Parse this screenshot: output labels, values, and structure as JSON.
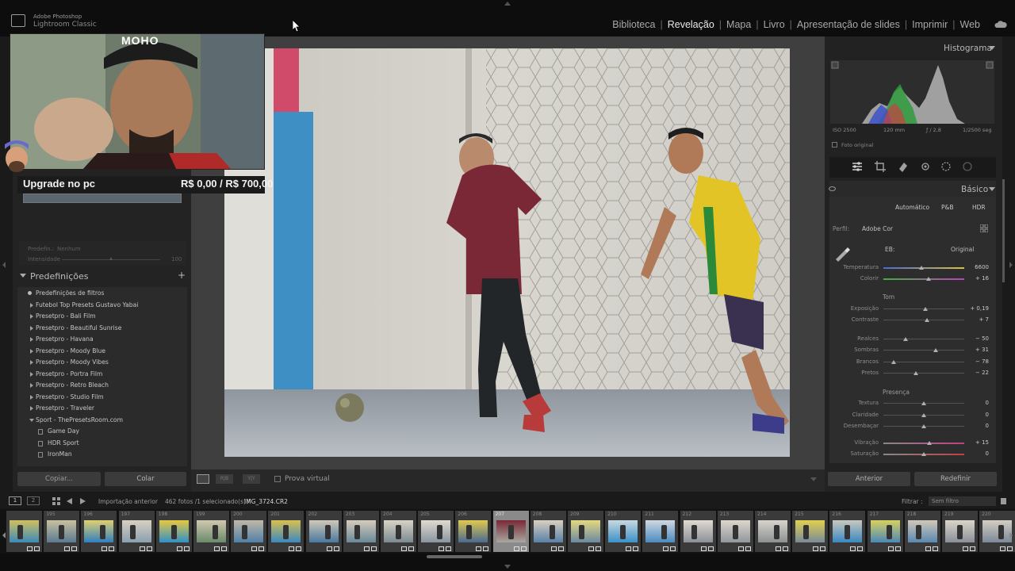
{
  "app": {
    "line1": "Adobe Photoshop",
    "line2": "Lightroom Classic"
  },
  "modules": [
    {
      "label": "Biblioteca",
      "active": false
    },
    {
      "label": "Revelação",
      "active": true
    },
    {
      "label": "Mapa",
      "active": false
    },
    {
      "label": "Livro",
      "active": false
    },
    {
      "label": "Apresentação de slides",
      "active": false
    },
    {
      "label": "Imprimir",
      "active": false
    },
    {
      "label": "Web",
      "active": false
    }
  ],
  "overlay": {
    "left_text": "Upgrade no pc",
    "right_text": "R$ 0,00 / R$ 700,00",
    "badge": "MOHO"
  },
  "left": {
    "preset_label": "Predefin.:",
    "preset_value": "Nenhum",
    "intensity_label": "Intensidade",
    "intensity_value": "100",
    "presets_title": "Predefinições",
    "items": [
      {
        "label": "Predefinições de filtros",
        "kind": "plain"
      },
      {
        "label": "Futebol Top Presets Gustavo Yabai",
        "kind": "folder"
      },
      {
        "label": "Presetpro - Bali Film",
        "kind": "folder"
      },
      {
        "label": "Presetpro - Beautiful Sunrise",
        "kind": "folder"
      },
      {
        "label": "Presetpro - Havana",
        "kind": "folder"
      },
      {
        "label": "Presetpro - Moody Blue",
        "kind": "folder"
      },
      {
        "label": "Presetpro - Moody Vibes",
        "kind": "folder"
      },
      {
        "label": "Presetpro - Portra Film",
        "kind": "folder"
      },
      {
        "label": "Presetpro - Retro Bleach",
        "kind": "folder"
      },
      {
        "label": "Presetpro - Studio Film",
        "kind": "folder"
      },
      {
        "label": "Presetpro - Traveler",
        "kind": "folder"
      },
      {
        "label": "Sport - ThePresetsRoom.com",
        "kind": "open"
      },
      {
        "label": "Game Day",
        "kind": "sub"
      },
      {
        "label": "HDR Sport",
        "kind": "sub"
      },
      {
        "label": "IronMan",
        "kind": "sub"
      }
    ],
    "copy_label": "Copiar...",
    "paste_label": "Colar"
  },
  "toolbar": {
    "view2": "R|B",
    "view3": "Y|Y",
    "proof_label": "Prova virtual"
  },
  "right": {
    "histogram_title": "Histograma",
    "hist_info": [
      "ISO 2500",
      "120 mm",
      "ƒ / 2,8",
      "1/2500 seg"
    ],
    "original_photo": "Foto original",
    "basic_title": "Básico",
    "modes": [
      "Automático",
      "P&B",
      "HDR"
    ],
    "profile_label": "Perfil:",
    "profile_value": "Adobe Cor",
    "wb_label": "EB:",
    "wb_value": "Original",
    "sections": {
      "tone": "Tom",
      "presence": "Presença"
    },
    "sliders": [
      {
        "label": "Temperatura",
        "value": "6600",
        "pos": 0.47,
        "group": "wb"
      },
      {
        "label": "Colorir",
        "value": "+ 16",
        "pos": 0.56,
        "group": "wb"
      },
      {
        "label": "Exposição",
        "value": "+ 0,19",
        "pos": 0.52,
        "group": "tone"
      },
      {
        "label": "Contraste",
        "value": "+ 7",
        "pos": 0.54,
        "group": "tone"
      },
      {
        "label": "Realces",
        "value": "− 50",
        "pos": 0.27,
        "group": "tone"
      },
      {
        "label": "Sombras",
        "value": "+ 31",
        "pos": 0.65,
        "group": "tone"
      },
      {
        "label": "Brancos",
        "value": "− 78",
        "pos": 0.13,
        "group": "tone"
      },
      {
        "label": "Pretos",
        "value": "− 22",
        "pos": 0.4,
        "group": "tone"
      },
      {
        "label": "Textura",
        "value": "0",
        "pos": 0.5,
        "group": "presence"
      },
      {
        "label": "Claridade",
        "value": "0",
        "pos": 0.5,
        "group": "presence"
      },
      {
        "label": "Desembaçar",
        "value": "0",
        "pos": 0.5,
        "group": "presence"
      },
      {
        "label": "Vibração",
        "value": "+ 15",
        "pos": 0.57,
        "group": "presence"
      },
      {
        "label": "Saturação",
        "value": "0",
        "pos": 0.5,
        "group": "presence"
      }
    ],
    "prev_label": "Anterior",
    "reset_label": "Redefinir"
  },
  "filmstrip_header": {
    "source": "Importação anterior",
    "count": "462 fotos /1 selecionado(s) /",
    "file": "IMG_3724.CR2",
    "filter_label": "Filtrar :",
    "filter_value": "Sem filtro"
  },
  "filmstrip": [
    {
      "num": "",
      "sel": false
    },
    {
      "num": "195",
      "sel": false
    },
    {
      "num": "196",
      "sel": false
    },
    {
      "num": "197",
      "sel": false
    },
    {
      "num": "198",
      "sel": false
    },
    {
      "num": "199",
      "sel": false
    },
    {
      "num": "200",
      "sel": false
    },
    {
      "num": "201",
      "sel": false
    },
    {
      "num": "202",
      "sel": false
    },
    {
      "num": "203",
      "sel": false
    },
    {
      "num": "204",
      "sel": false
    },
    {
      "num": "205",
      "sel": false
    },
    {
      "num": "206",
      "sel": false
    },
    {
      "num": "207",
      "sel": true
    },
    {
      "num": "208",
      "sel": false
    },
    {
      "num": "209",
      "sel": false
    },
    {
      "num": "210",
      "sel": false
    },
    {
      "num": "211",
      "sel": false
    },
    {
      "num": "212",
      "sel": false
    },
    {
      "num": "213",
      "sel": false
    },
    {
      "num": "214",
      "sel": false
    },
    {
      "num": "215",
      "sel": false
    },
    {
      "num": "216",
      "sel": false
    },
    {
      "num": "217",
      "sel": false
    },
    {
      "num": "218",
      "sel": false
    },
    {
      "num": "219",
      "sel": false
    },
    {
      "num": "220",
      "sel": false
    }
  ]
}
